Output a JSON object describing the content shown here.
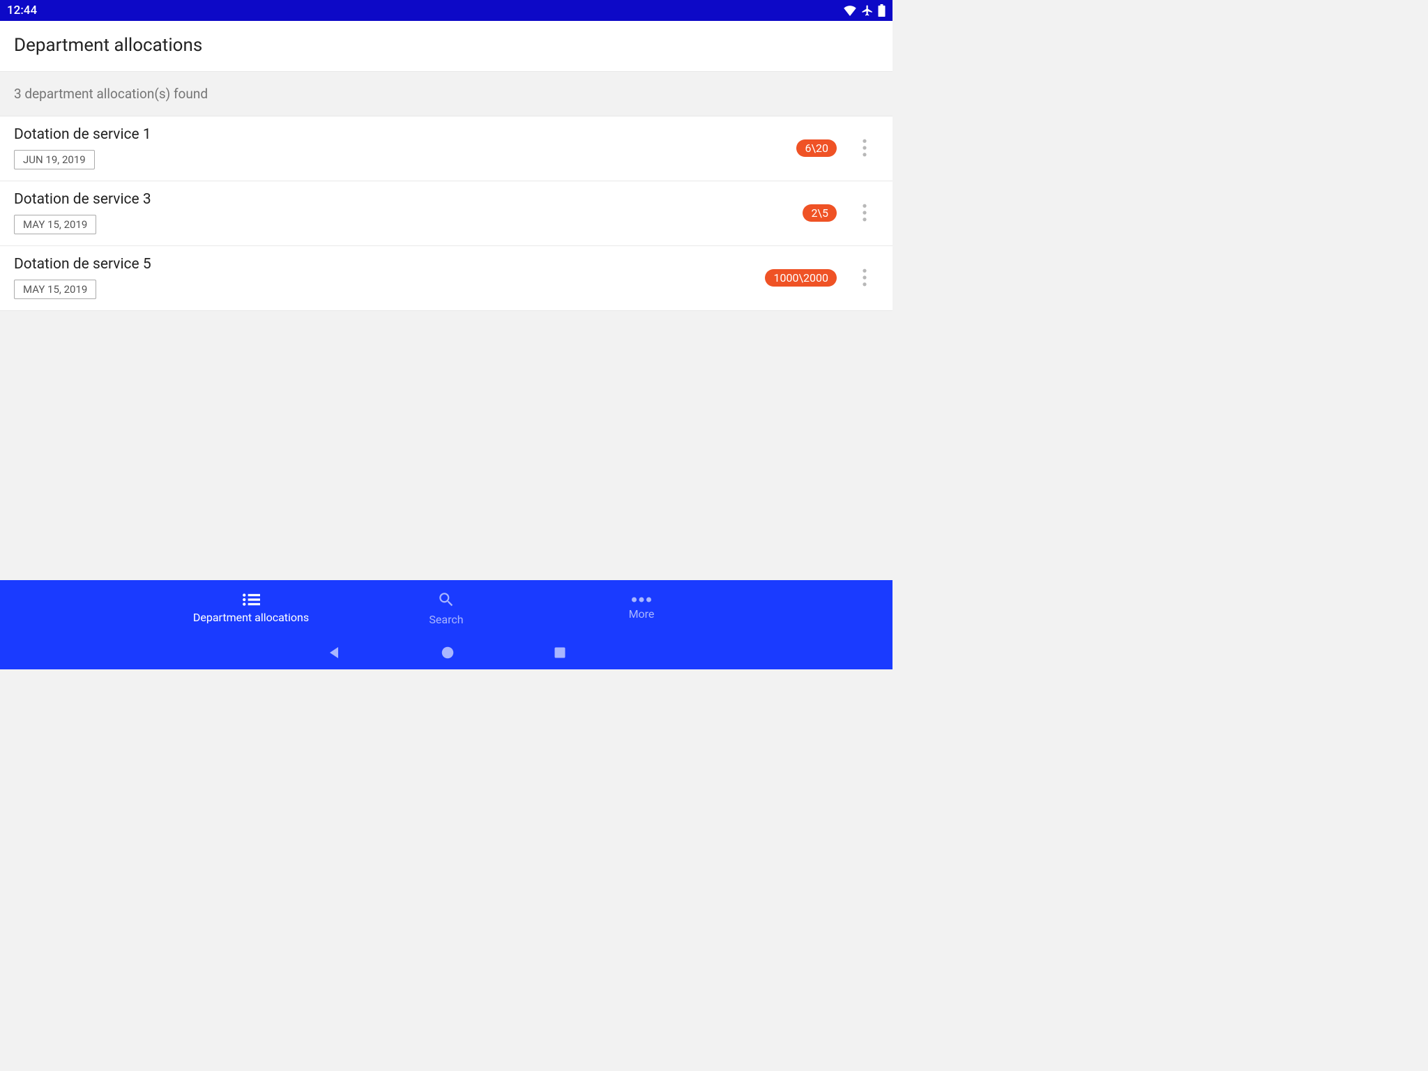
{
  "status_bar": {
    "time": "12:44"
  },
  "app_bar": {
    "title": "Department allocations"
  },
  "summary": {
    "text": "3 department allocation(s) found"
  },
  "rows": [
    {
      "title": "Dotation de service 1",
      "date": "JUN 19, 2019",
      "badge": "6\\20"
    },
    {
      "title": "Dotation de service 3",
      "date": "MAY 15, 2019",
      "badge": "2\\5"
    },
    {
      "title": "Dotation de service 5",
      "date": "MAY 15, 2019",
      "badge": "1000\\2000"
    }
  ],
  "bottom_nav": {
    "items": [
      {
        "label": "Department allocations"
      },
      {
        "label": "Search"
      },
      {
        "label": "More"
      }
    ]
  }
}
